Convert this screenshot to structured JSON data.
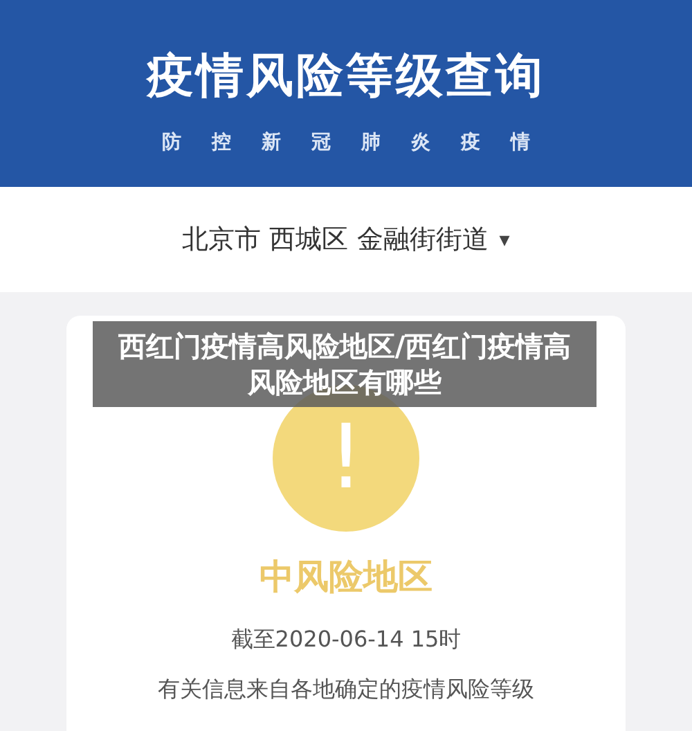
{
  "header": {
    "title": "疫情风险等级查询",
    "subtitle": "防控新冠肺炎疫情"
  },
  "location": {
    "label": "北京市 西城区 金融街街道",
    "caret": "▾"
  },
  "result": {
    "kind": "medium",
    "mark": "!",
    "label": "中风险地区",
    "time": "截至2020-06-14 15时",
    "note": "有关信息来自各地确定的疫情风险等级"
  },
  "caption": {
    "text": "西红门疫情高风险地区/西红门疫情高风险地区有哪些"
  }
}
